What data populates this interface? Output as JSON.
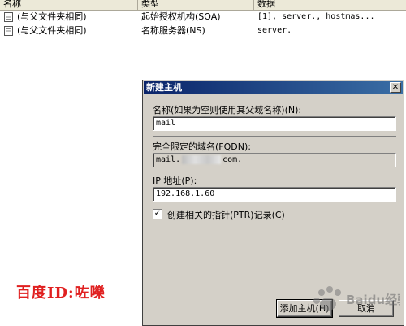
{
  "list": {
    "columns": [
      "名称",
      "类型",
      "数据"
    ],
    "rows": [
      {
        "name": "(与父文件夹相同)",
        "type": "起始授权机构(SOA)",
        "data": "[1], server., hostmas..."
      },
      {
        "name": "(与父文件夹相同)",
        "type": "名称服务器(NS)",
        "data": "server."
      }
    ]
  },
  "dialog": {
    "title": "新建主机",
    "close_glyph": "✕",
    "name_label": "名称(如果为空则使用其父域名称)(N):",
    "name_value": "mail",
    "fqdn_label": "完全限定的域名(FQDN):",
    "fqdn_prefix": "mail.",
    "fqdn_suffix": "com.",
    "ip_label": "IP 地址(P):",
    "ip_value": "192.168.1.60",
    "ptr_checked": true,
    "ptr_check_glyph": "✓",
    "ptr_label": "创建相关的指针(PTR)记录(C)",
    "add_button": "添加主机(H)",
    "cancel_button": "取消"
  },
  "watermark": {
    "text": "百度ID:咗嚛",
    "logo_text": "Baidu经验"
  },
  "colors": {
    "title_bar": "#0a246a",
    "dialog_face": "#d4d0c8",
    "watermark": "#e02020"
  }
}
